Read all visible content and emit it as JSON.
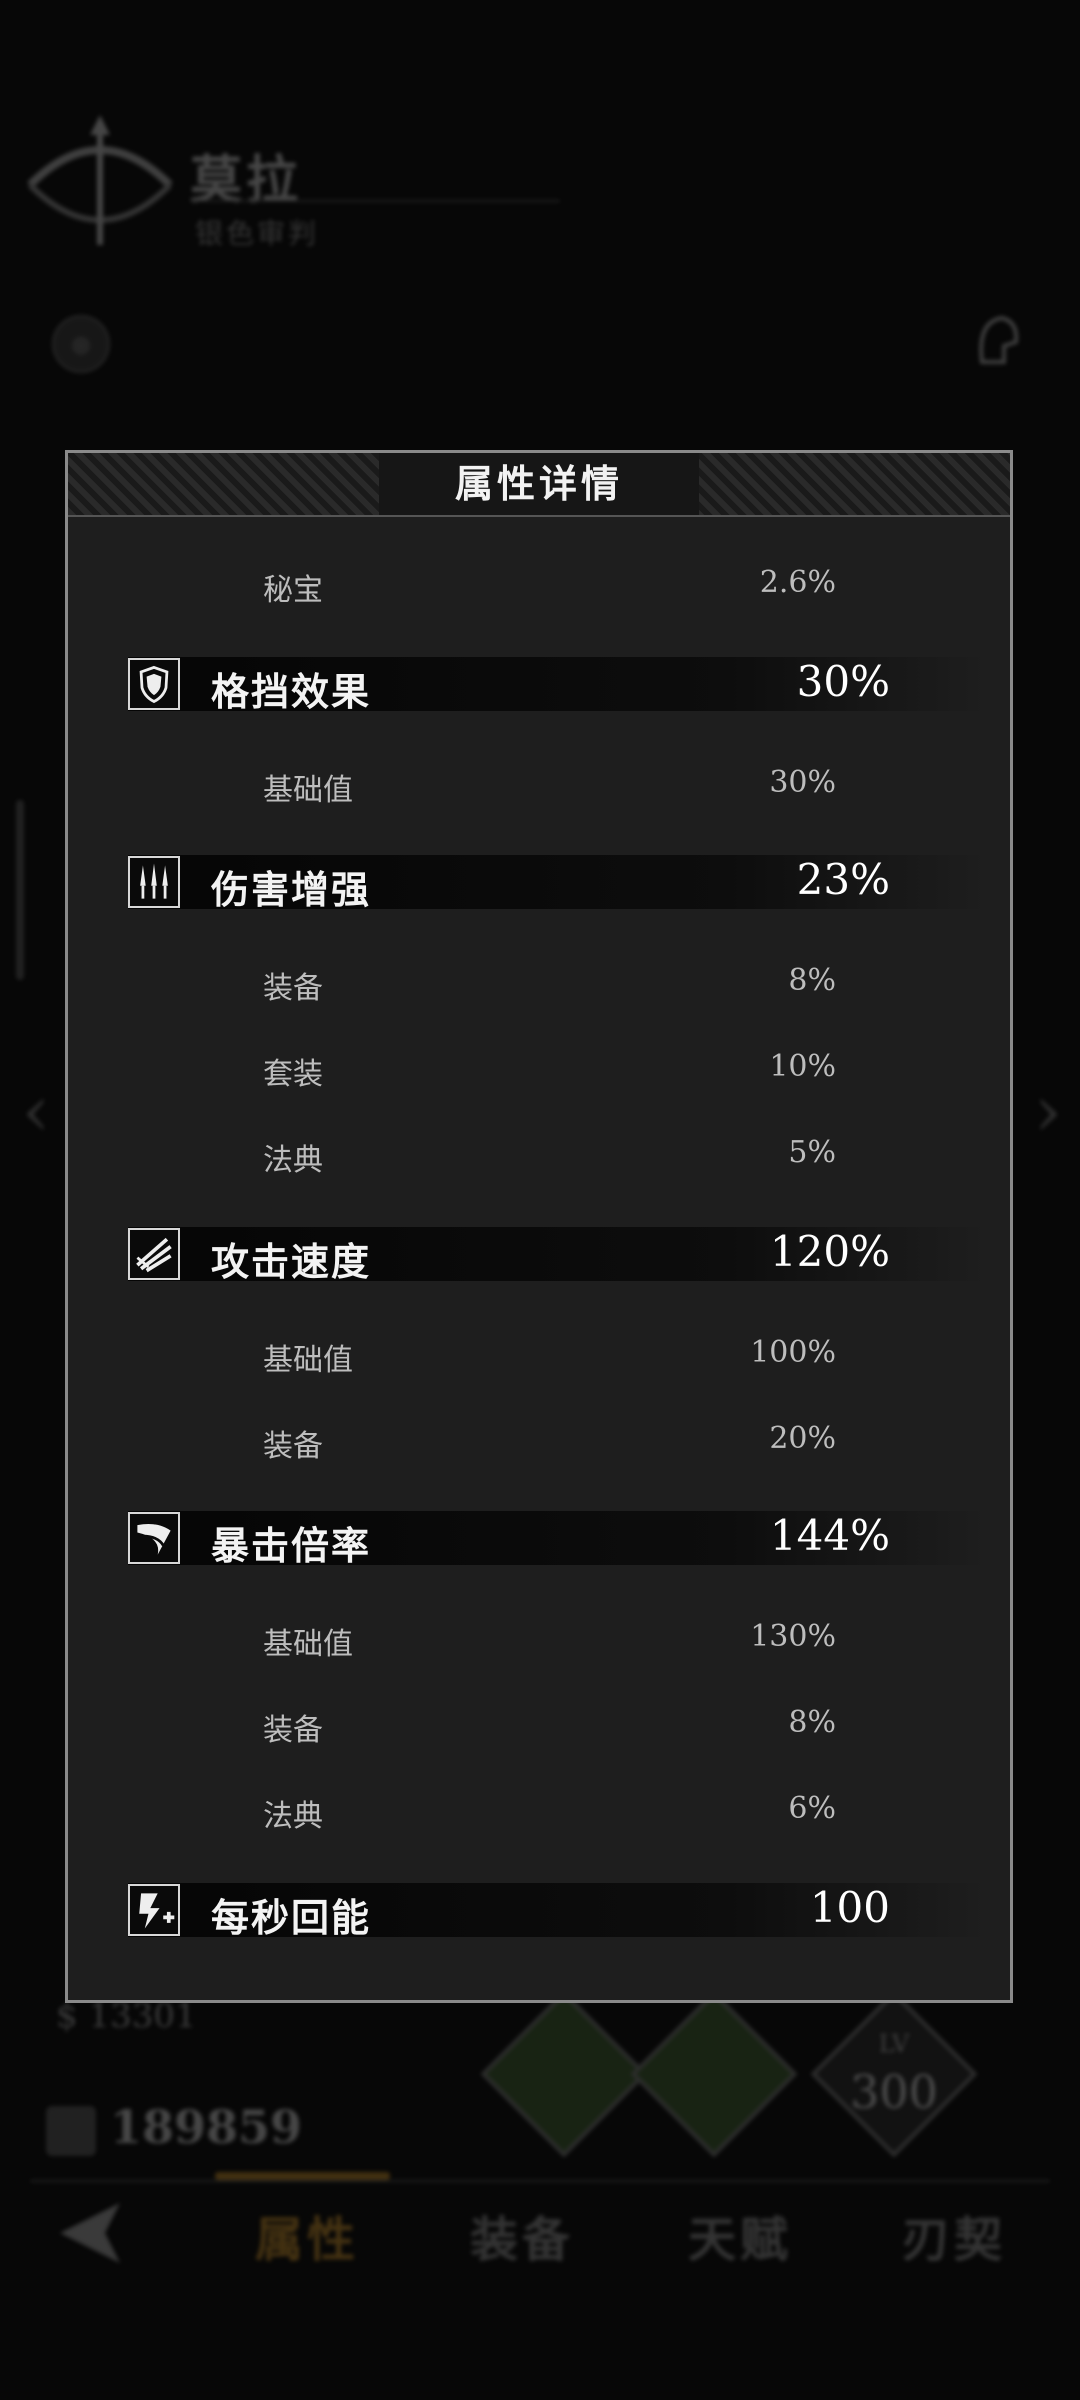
{
  "background": {
    "hero_name": "莫拉",
    "hero_subtitle": "银色审判",
    "power_small": "$ 13301",
    "power_value": "189859",
    "level_label": "LV",
    "level_value": "300",
    "tabs": [
      "属性",
      "装备",
      "天赋",
      "刃契"
    ],
    "active_tab": "属性",
    "colors": {
      "accent": "#d89a2a",
      "skill_green": "#3c5b2e"
    }
  },
  "modal": {
    "title": "属性详情",
    "top_sub": {
      "label": "秘宝",
      "value": "2.6%"
    },
    "sections": [
      {
        "icon": "shield-icon",
        "label": "格挡效果",
        "value": "30%",
        "items": [
          {
            "label": "基础值",
            "value": "30%"
          }
        ]
      },
      {
        "icon": "triple-dagger-icon",
        "label": "伤害增强",
        "value": "23%",
        "items": [
          {
            "label": "装备",
            "value": "8%"
          },
          {
            "label": "套装",
            "value": "10%"
          },
          {
            "label": "法典",
            "value": "5%"
          }
        ]
      },
      {
        "icon": "wind-slash-icon",
        "label": "攻击速度",
        "value": "120%",
        "items": [
          {
            "label": "基础值",
            "value": "100%"
          },
          {
            "label": "装备",
            "value": "20%"
          }
        ]
      },
      {
        "icon": "claw-icon",
        "label": "暴击倍率",
        "value": "144%",
        "items": [
          {
            "label": "基础值",
            "value": "130%"
          },
          {
            "label": "装备",
            "value": "8%"
          },
          {
            "label": "法典",
            "value": "6%"
          }
        ]
      },
      {
        "icon": "energy-plus-icon",
        "label": "每秒回能",
        "value": "100",
        "items": []
      }
    ]
  }
}
